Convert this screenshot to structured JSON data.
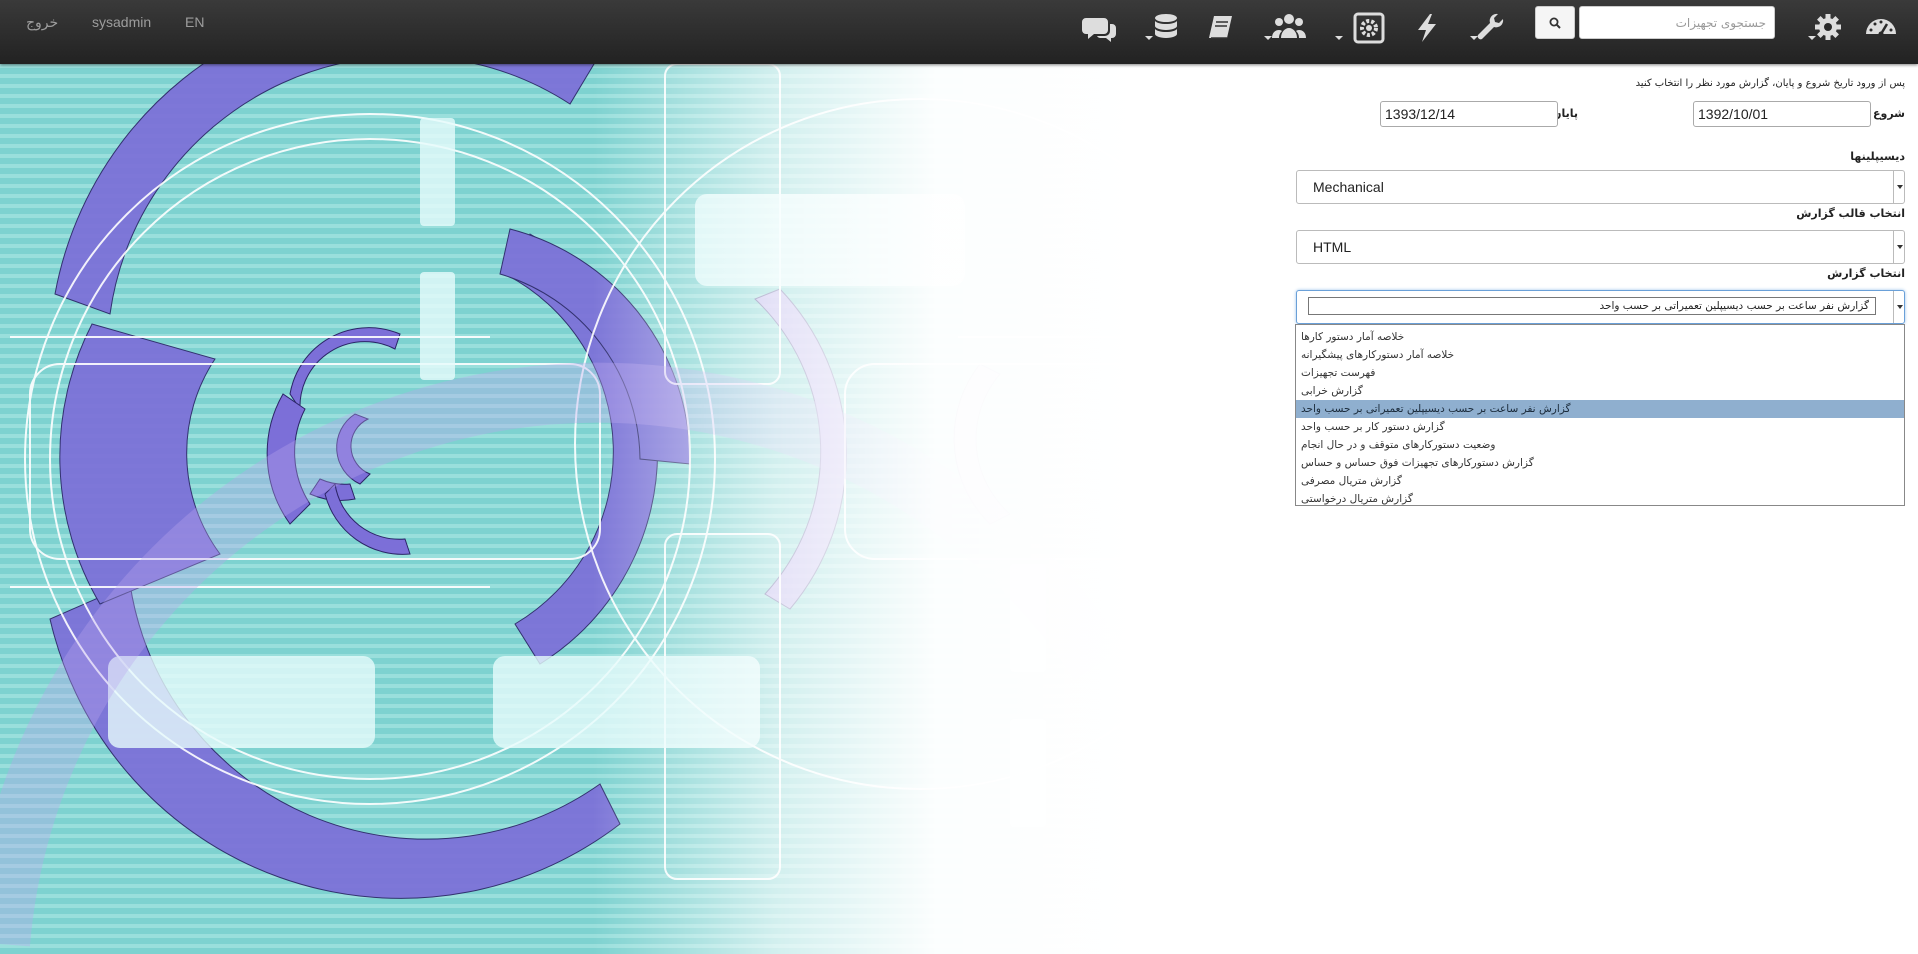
{
  "navbar": {
    "lang_link": "EN",
    "user": "sysadmin",
    "logout": "خروج",
    "search_placeholder": "جستجوی تجهیزات"
  },
  "icons": [
    "chat-icon",
    "database-icon",
    "book-icon",
    "users-icon",
    "equipment-icon",
    "lightning-icon",
    "wrench-icon",
    "search-icon",
    "settings-icon",
    "dashboard-icon"
  ],
  "form": {
    "hint": "پس از ورود تاریخ شروع و پایان، گزارش مورد نظر را انتخاب کنید",
    "start_label": "شروع",
    "start_value": "1392/10/01",
    "end_label": "پایان",
    "end_value": "1393/12/14",
    "discipline_label": "دیسیپلینها",
    "discipline_value": "Mechanical",
    "template_label": "انتخاب قالب گزارش",
    "template_value": "HTML",
    "report_label": "انتخاب گزارش",
    "report_value": "گزارش نفر ساعت بر حسب دیسیپلین تعمیراتی بر حسب واحد",
    "report_options": [
      "خلاصه آمار دستور کارها",
      "خلاصه آمار دستورکارهای پیشگیرانه",
      "فهرست تجهیزات",
      "گزارش خرابی",
      "گزارش نفر ساعت بر حسب دیسیپلین تعمیراتی بر حسب واحد",
      "گزارش دستور کار بر حسب واحد",
      "وضعیت دستورکارهای متوقف و در حال انجام",
      "گزارش دستورکارهای تجهیزات فوق حساس و حساس",
      "گزارش متریال مصرفی",
      "گزارش متریال درخواستی"
    ],
    "selected_index": 4
  },
  "colors": {
    "navbar": "#2a2a2a",
    "teal": "#7fcfcf",
    "purple": "#7b6fd6",
    "selected_option": "#8fafcf"
  }
}
